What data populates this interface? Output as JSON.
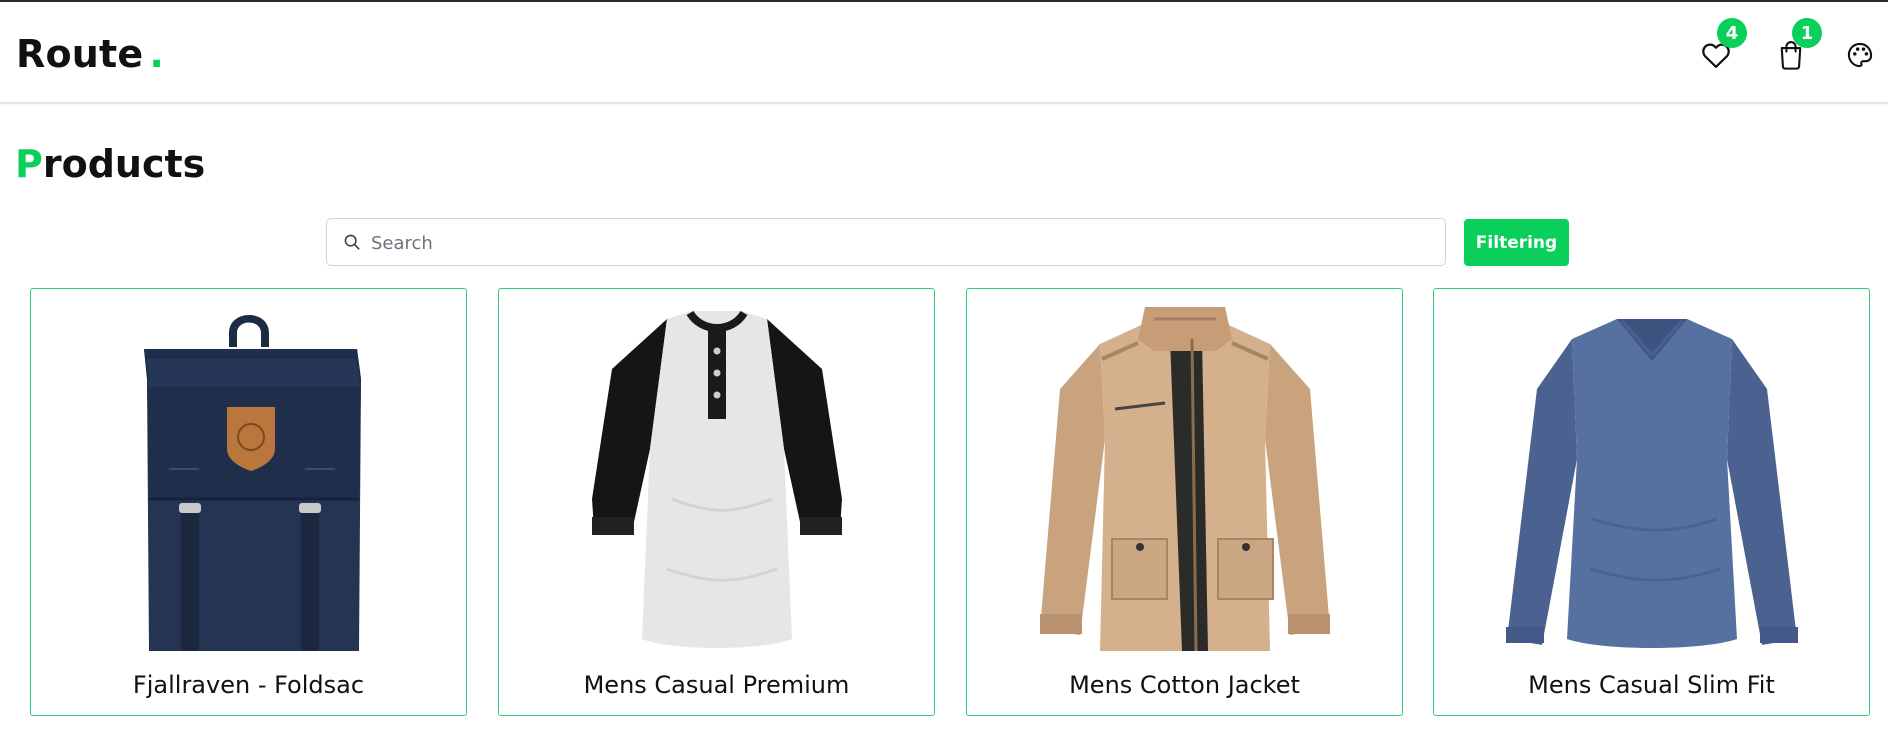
{
  "brand": {
    "name": "Route",
    "dot": "."
  },
  "nav": {
    "wishlist_count": "4",
    "cart_count": "1",
    "icons": [
      "heart-icon",
      "shopping-bag-icon",
      "palette-icon"
    ]
  },
  "page": {
    "title_first_letter": "P",
    "title_rest": "roducts"
  },
  "search": {
    "placeholder": "Search",
    "value": ""
  },
  "filter": {
    "label": "Filtering"
  },
  "products": [
    {
      "name": "Fjallraven - Foldsac",
      "image": "backpack"
    },
    {
      "name": "Mens Casual Premium",
      "image": "raglan-tshirt"
    },
    {
      "name": "Mens Cotton Jacket",
      "image": "jacket"
    },
    {
      "name": "Mens Casual Slim Fit",
      "image": "longsleeve-tshirt"
    }
  ],
  "colors": {
    "accent": "#0acf5a",
    "card_border": "#2fcf7a",
    "text": "#111111"
  }
}
